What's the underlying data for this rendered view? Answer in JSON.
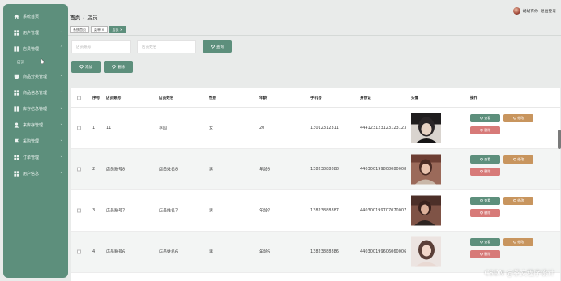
{
  "sidebar": {
    "items": [
      {
        "label": "系统首页",
        "icon": "home-icon",
        "chevron": false
      },
      {
        "label": "用户管理",
        "icon": "grid-icon",
        "chevron": true
      },
      {
        "label": "店员管理",
        "icon": "grid-icon",
        "chevron": true
      },
      {
        "label": "商品分类管理",
        "icon": "shield-icon",
        "chevron": true
      },
      {
        "label": "商品信息管理",
        "icon": "grid-icon",
        "chevron": true
      },
      {
        "label": "库存信息管理",
        "icon": "grid-icon",
        "chevron": true
      },
      {
        "label": "来库存管理",
        "icon": "person-icon",
        "chevron": true
      },
      {
        "label": "采购管理",
        "icon": "flag-icon",
        "chevron": true
      },
      {
        "label": "订单管理",
        "icon": "grid-icon",
        "chevron": true
      },
      {
        "label": "用户信息",
        "icon": "grid-icon",
        "chevron": true
      }
    ],
    "sub_item": "店员"
  },
  "header": {
    "breadcrumb_home": "首页",
    "breadcrumb_sep": "/",
    "breadcrumb_current": "店员",
    "user_name": "胡胡有你",
    "logout": "退出登录"
  },
  "tabs": [
    "系统首页",
    "菜单 ×",
    "店员 ×"
  ],
  "search": {
    "account_placeholder": "店员账号",
    "name_placeholder": "店员姓名",
    "search_label": "查询"
  },
  "actions": {
    "add_label": "添加",
    "delete_label": "删除"
  },
  "table": {
    "headers": {
      "index": "序号",
      "account": "店员账号",
      "name": "店员姓名",
      "gender": "性别",
      "age": "年龄",
      "phone": "手机号",
      "idcard": "身份证",
      "avatar": "头像",
      "ops": "操作"
    },
    "row_actions": {
      "view": "查看",
      "edit": "修改",
      "delete": "删除"
    },
    "rows": [
      {
        "index": "1",
        "account": "11",
        "name": "李四",
        "gender": "女",
        "age": "20",
        "phone": "13012312311",
        "idcard": "444123123123123123"
      },
      {
        "index": "2",
        "account": "店员账号8",
        "name": "店员姓名8",
        "gender": "男",
        "age": "年龄8",
        "phone": "13823888888",
        "idcard": "440300199808080008"
      },
      {
        "index": "3",
        "account": "店员账号7",
        "name": "店员姓名7",
        "gender": "男",
        "age": "年龄7",
        "phone": "13823888887",
        "idcard": "440300199707070007"
      },
      {
        "index": "4",
        "account": "店员账号6",
        "name": "店员姓名6",
        "gender": "男",
        "age": "年龄6",
        "phone": "13823888886",
        "idcard": "440300199606060006"
      }
    ]
  },
  "watermark": "CSDN @茶文程序设计",
  "colors": {
    "primary": "#5d8f7c",
    "edit": "#c8955e",
    "delete": "#d77a78",
    "background": "#e9ebea"
  }
}
